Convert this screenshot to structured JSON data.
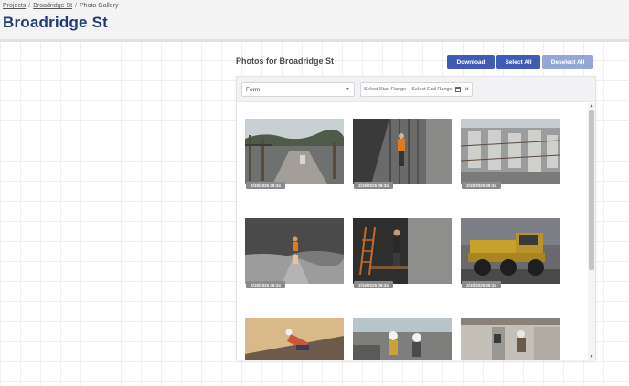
{
  "breadcrumb": {
    "items": [
      {
        "label": "Projects"
      },
      {
        "label": "Broadridge St"
      },
      {
        "label": "Photo Gallery"
      }
    ],
    "separator": "/"
  },
  "page_title": "Broadridge St",
  "section_title": "Photos for Broadridge St",
  "toolbar": {
    "download_label": "Download",
    "select_all_label": "Select All",
    "deselect_all_label": "Deselect All"
  },
  "colors": {
    "title": "#233a7a",
    "primary_button": "#3f5bb5",
    "disabled_button": "#97a6d8",
    "badge": "#8b8b8f"
  },
  "filters": {
    "form_select_value": "Form",
    "date_range_text": "Select Start Range – Select End Range",
    "calendar_icon": "calendar-icon",
    "clear_icon": "×"
  },
  "photos": [
    {
      "date": "2/19/2025 09:34",
      "subject": "muddy construction site with fencing and trees"
    },
    {
      "date": "2/19/2025 09:34",
      "subject": "worker in orange vest on scaffold"
    },
    {
      "date": "2/19/2025 09:34",
      "subject": "concrete formwork and rebar aerial"
    },
    {
      "date": "2/19/2025 09:34",
      "subject": "black and white excavation with worker in orange"
    },
    {
      "date": "2/19/2025 09:34",
      "subject": "worker with ladder indoors"
    },
    {
      "date": "2/19/2025 09:34",
      "subject": "yellow articulated dump truck"
    },
    {
      "date": "",
      "subject": "worker kneeling on floor"
    },
    {
      "date": "",
      "subject": "workers with hard hats outdoors"
    },
    {
      "date": "",
      "subject": "workers at concrete pillar"
    }
  ]
}
